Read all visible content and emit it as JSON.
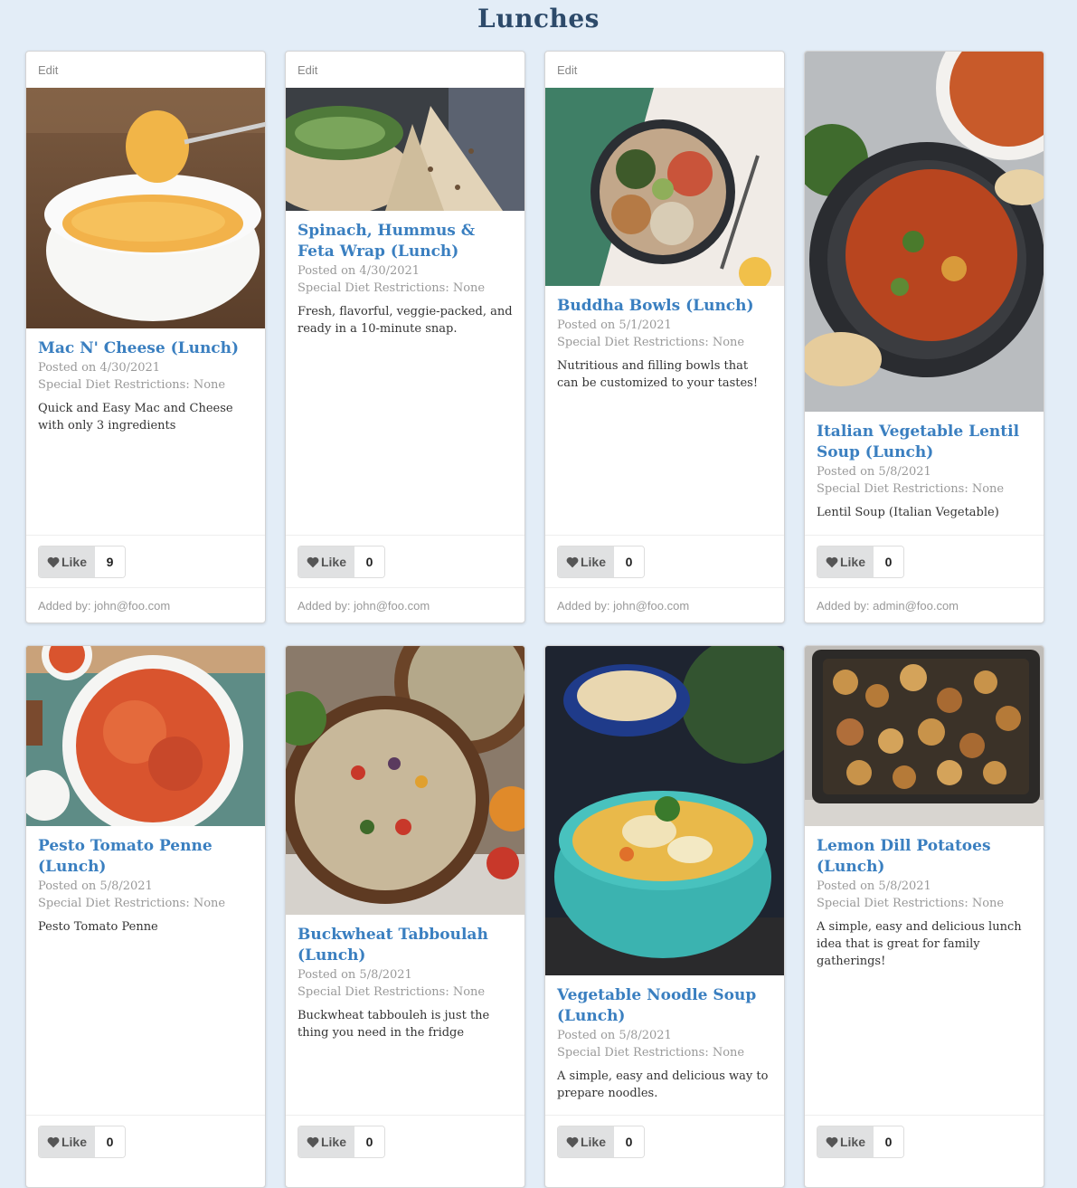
{
  "page": {
    "title": "Lunches"
  },
  "ui": {
    "edit_label": "Edit",
    "like_label": "Like"
  },
  "cards": [
    {
      "title": "Mac N' Cheese (Lunch)",
      "posted": "Posted on 4/30/2021",
      "diet": "Special Diet Restrictions: None",
      "description": "Quick and Easy Mac and Cheese with only 3 ingredients",
      "likes": "9",
      "added_by": "Added by: john@foo.com",
      "image": "bowl-of-mac-and-cheese-image"
    },
    {
      "title": "Spinach, Hummus & Feta Wrap (Lunch)",
      "posted": "Posted on 4/30/2021",
      "diet": "Special Diet Restrictions: None",
      "description": "Fresh, flavorful, veggie-packed, and ready in a 10-minute snap.",
      "likes": "0",
      "added_by": "Added by: john@foo.com",
      "image": "spinach-wraps-image"
    },
    {
      "title": "Buddha Bowls (Lunch)",
      "posted": "Posted on 5/1/2021",
      "diet": "Special Diet Restrictions: None",
      "description": "Nutritious and filling bowls that can be customized to your tastes!",
      "likes": "0",
      "added_by": "Added by: john@foo.com",
      "image": "buddha-bowl-image"
    },
    {
      "title": "Italian Vegetable Lentil Soup (Lunch)",
      "posted": "Posted on 5/8/2021",
      "diet": "Special Diet Restrictions: None",
      "description": "Lentil Soup (Italian Vegetable)",
      "likes": "0",
      "added_by": "Added by: admin@foo.com",
      "image": "lentil-soup-image"
    },
    {
      "title": "Pesto Tomato Penne (Lunch)",
      "posted": "Posted on 5/8/2021",
      "diet": "Special Diet Restrictions: None",
      "description": "Pesto Tomato Penne",
      "likes": "0",
      "image": "penne-pasta-image"
    },
    {
      "title": "Buckwheat Tabboulah (Lunch)",
      "posted": "Posted on 5/8/2021",
      "diet": "Special Diet Restrictions: None",
      "description": "Buckwheat tabbouleh is just the thing you need in the fridge",
      "likes": "0",
      "image": "tabbouleh-salad-image"
    },
    {
      "title": "Vegetable Noodle Soup (Lunch)",
      "posted": "Posted on 5/8/2021",
      "diet": "Special Diet Restrictions: None",
      "description": "A simple, easy and delicious way to prepare noodles.",
      "likes": "0",
      "image": "noodle-soup-image"
    },
    {
      "title": "Lemon Dill Potatoes (Lunch)",
      "posted": "Posted on 5/8/2021",
      "diet": "Special Diet Restrictions: None",
      "description": "A simple, easy and delicious lunch idea that is great for family gatherings!",
      "likes": "0",
      "image": "roasted-potatoes-image"
    }
  ]
}
